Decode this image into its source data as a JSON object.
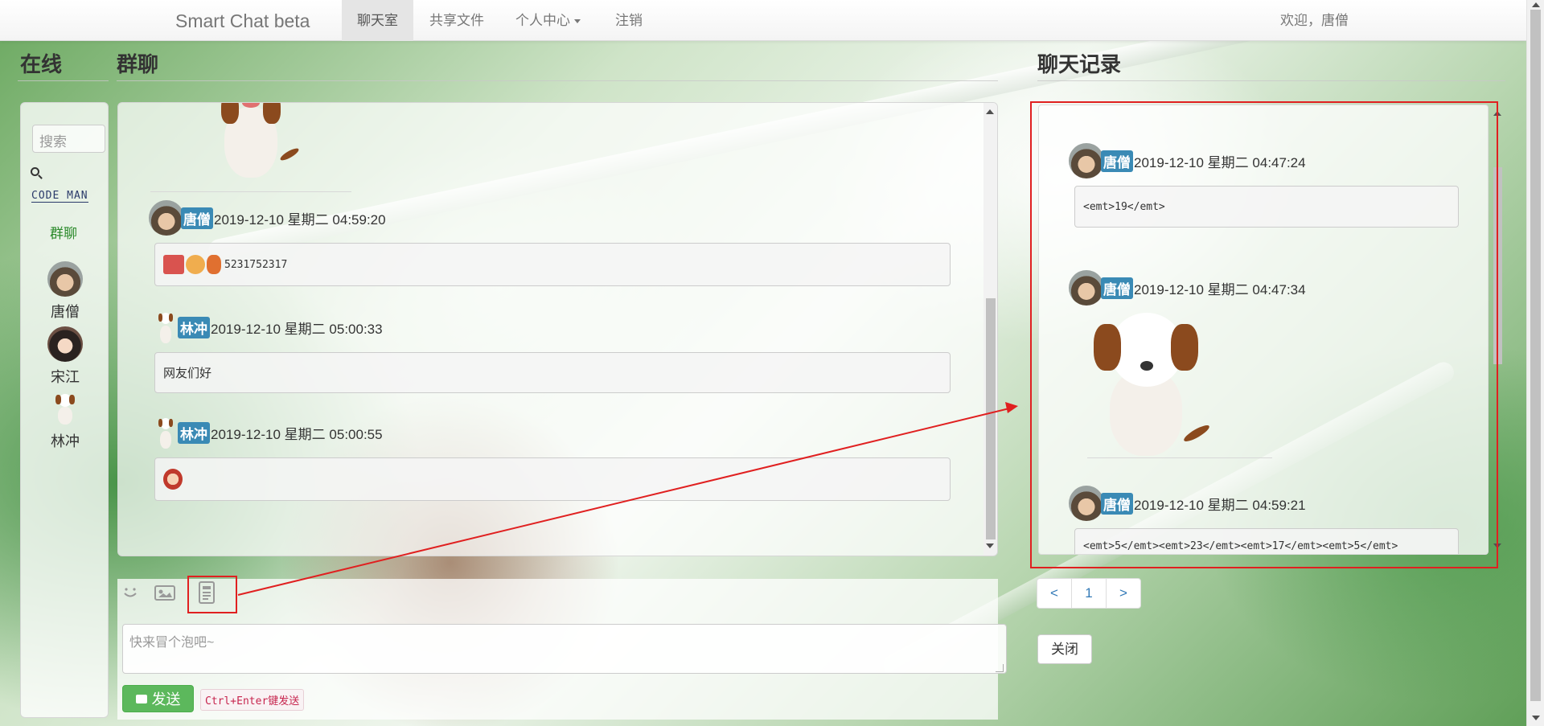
{
  "navbar": {
    "brand": "Smart Chat beta",
    "items": [
      {
        "label": "聊天室",
        "active": true
      },
      {
        "label": "共享文件",
        "active": false
      },
      {
        "label": "个人中心",
        "active": false
      },
      {
        "label": "注销",
        "active": false
      }
    ],
    "welcome": "欢迎，唐僧"
  },
  "online_panel": {
    "title": "在线",
    "search_placeholder": "搜索",
    "logo_text": "CODE MAN",
    "group_link": "群聊",
    "users": [
      {
        "name": "唐僧",
        "avatar": "avatar-tangseng"
      },
      {
        "name": "宋江",
        "avatar": "avatar-songjiang"
      },
      {
        "name": "林冲",
        "avatar": "avatar-dog"
      }
    ]
  },
  "chat": {
    "title": "群聊",
    "messages": [
      {
        "user": "唐僧",
        "time": "2019-12-10 星期二 04:59:20",
        "content": "5231752317",
        "emoji_prefix": true
      },
      {
        "user": "林冲",
        "time": "2019-12-10 星期二 05:00:33",
        "content": "网友们好"
      },
      {
        "user": "林冲",
        "time": "2019-12-10 星期二 05:00:55",
        "content": "",
        "emoji_only": true
      }
    ],
    "input_placeholder": "快来冒个泡吧~",
    "send_label": "发送",
    "send_hint": "Ctrl+Enter键发送",
    "tools": [
      "smile-icon",
      "image-icon",
      "history-icon"
    ]
  },
  "history": {
    "title": "聊天记录",
    "records": [
      {
        "user": "唐僧",
        "time": "2019-12-10 星期二 04:47:24",
        "content": "<emt>19</emt>"
      },
      {
        "user": "唐僧",
        "time": "2019-12-10 星期二 04:47:34",
        "content": "",
        "image": "dog-sticker"
      },
      {
        "user": "唐僧",
        "time": "2019-12-10 星期二 04:59:21",
        "content": "<emt>5</emt><emt>23</emt><emt>17</emt><emt>5</emt>"
      }
    ],
    "pagination": [
      "<",
      "1",
      ">"
    ],
    "close_label": "关闭"
  },
  "colors": {
    "accent": "#337ab7",
    "send_button": "#5cb85c",
    "username_badge": "#3a8ab5",
    "annotation_red": "#e02020"
  }
}
